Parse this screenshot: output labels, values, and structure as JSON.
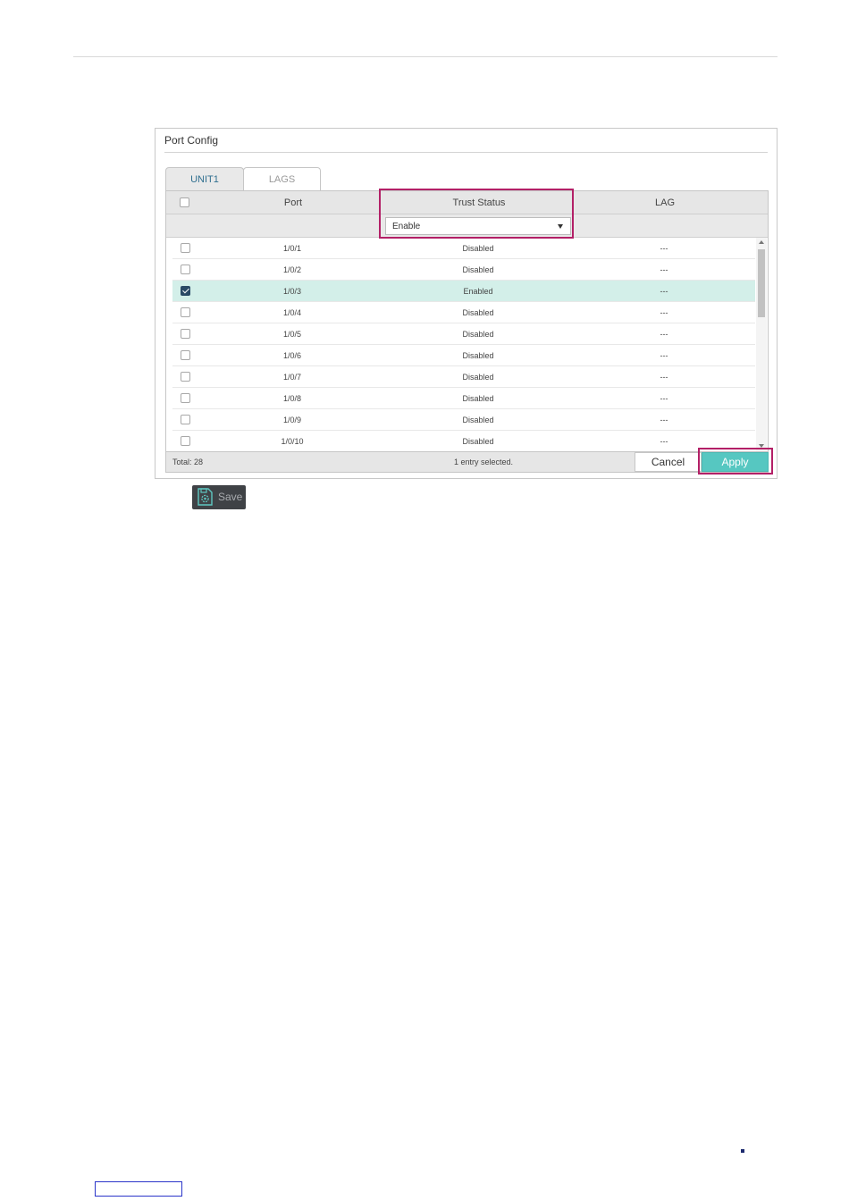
{
  "panel": {
    "title": "Port Config"
  },
  "tabs": [
    {
      "label": "UNIT1",
      "active": true
    },
    {
      "label": "LAGS",
      "active": false
    }
  ],
  "table": {
    "columns": {
      "port": "Port",
      "trust": "Trust Status",
      "lag": "LAG"
    },
    "filter": {
      "trust_value": "Enable"
    },
    "rows": [
      {
        "port": "1/0/1",
        "trust": "Disabled",
        "lag": "---",
        "checked": false
      },
      {
        "port": "1/0/2",
        "trust": "Disabled",
        "lag": "---",
        "checked": false
      },
      {
        "port": "1/0/3",
        "trust": "Enabled",
        "lag": "---",
        "checked": true
      },
      {
        "port": "1/0/4",
        "trust": "Disabled",
        "lag": "---",
        "checked": false
      },
      {
        "port": "1/0/5",
        "trust": "Disabled",
        "lag": "---",
        "checked": false
      },
      {
        "port": "1/0/6",
        "trust": "Disabled",
        "lag": "---",
        "checked": false
      },
      {
        "port": "1/0/7",
        "trust": "Disabled",
        "lag": "---",
        "checked": false
      },
      {
        "port": "1/0/8",
        "trust": "Disabled",
        "lag": "---",
        "checked": false
      },
      {
        "port": "1/0/9",
        "trust": "Disabled",
        "lag": "---",
        "checked": false
      },
      {
        "port": "1/0/10",
        "trust": "Disabled",
        "lag": "---",
        "checked": false
      }
    ]
  },
  "footer": {
    "total": "Total: 28",
    "selected": "1 entry selected.",
    "cancel_label": "Cancel",
    "apply_label": "Apply"
  },
  "save": {
    "label": "Save",
    "icon": "save-gear-icon"
  },
  "colors": {
    "accent": "#56c7c1",
    "selected_row": "#d3efe9",
    "highlight": "#b32067",
    "checkbox_checked": "#2a4a66"
  }
}
